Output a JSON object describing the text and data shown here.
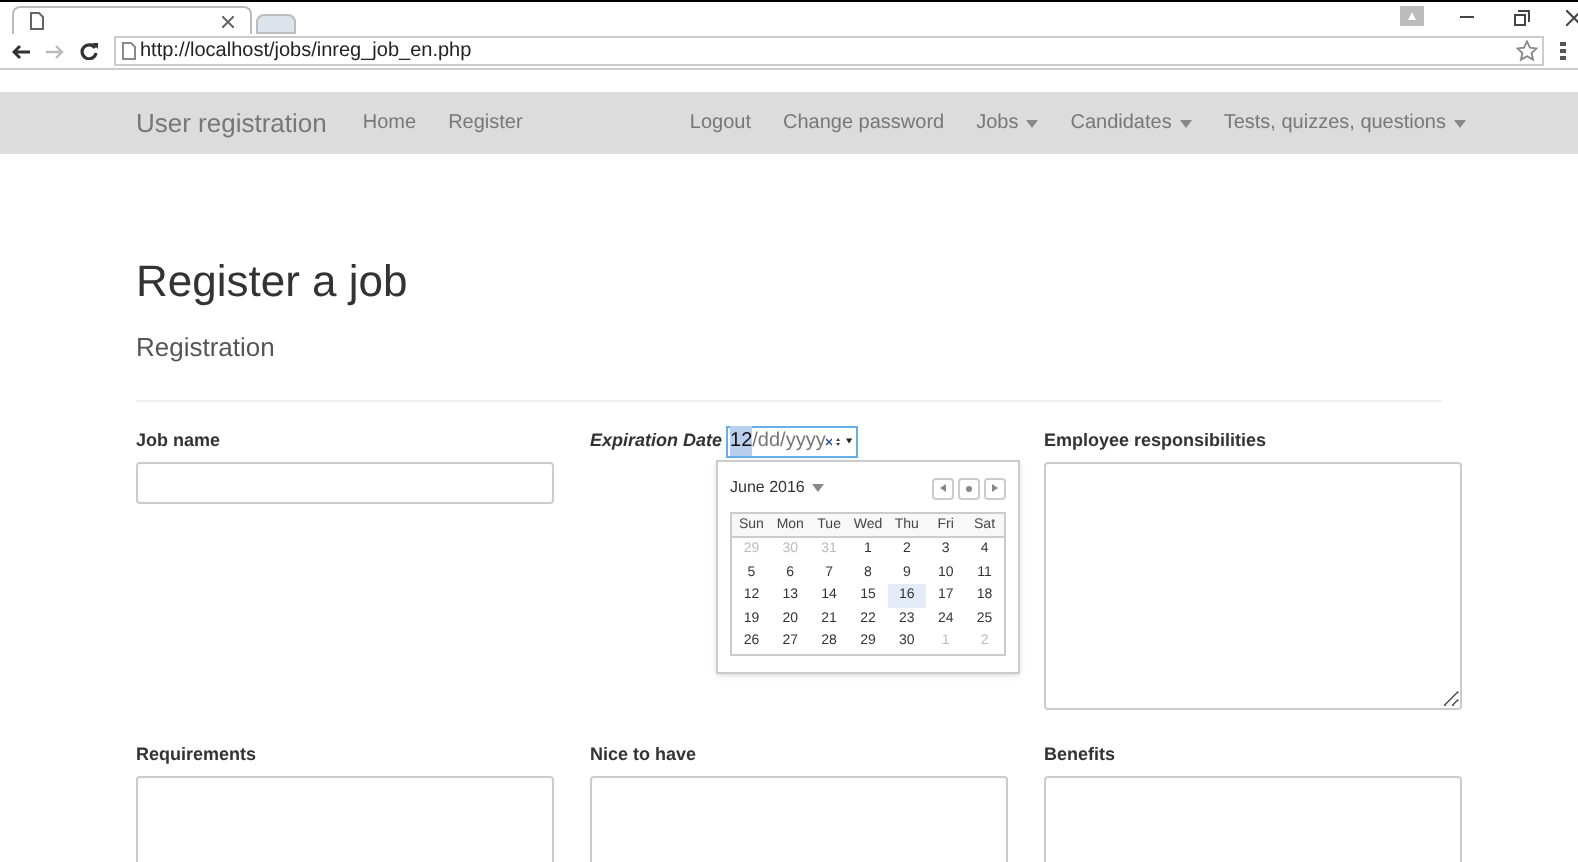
{
  "browser": {
    "url": "http://localhost/jobs/inreg_job_en.php"
  },
  "navbar": {
    "brand": "User registration",
    "left_links": [
      {
        "label": "Home",
        "dropdown": false
      },
      {
        "label": "Register",
        "dropdown": false
      }
    ],
    "right_links": [
      {
        "label": "Logout",
        "dropdown": false
      },
      {
        "label": "Change password",
        "dropdown": false
      },
      {
        "label": "Jobs",
        "dropdown": true
      },
      {
        "label": "Candidates",
        "dropdown": true
      },
      {
        "label": "Tests, quizzes, questions",
        "dropdown": true
      }
    ]
  },
  "page": {
    "title": "Register a job",
    "subtitle": "Registration"
  },
  "fields": [
    {
      "label": "Job name",
      "kind": "input",
      "italic": false
    },
    {
      "label": "Expiration Date",
      "kind": "date",
      "italic": true
    },
    {
      "label": "Employee responsibilities",
      "kind": "textarea",
      "italic": false
    },
    {
      "label": "Requirements",
      "kind": "textarea",
      "italic": false
    },
    {
      "label": "Nice to have",
      "kind": "textarea",
      "italic": false
    },
    {
      "label": "Benefits",
      "kind": "textarea",
      "italic": false
    }
  ],
  "date_field": {
    "segments": [
      {
        "text": "12",
        "selected": true
      },
      {
        "text": "/dd/yyyy",
        "selected": false
      }
    ]
  },
  "calendar": {
    "month": "June 2016",
    "weekdays": [
      "Sun",
      "Mon",
      "Tue",
      "Wed",
      "Thu",
      "Fri",
      "Sat"
    ],
    "weeks": [
      [
        {
          "day": "29",
          "muted": true,
          "selected": false
        },
        {
          "day": "30",
          "muted": true,
          "selected": false
        },
        {
          "day": "31",
          "muted": true,
          "selected": false
        },
        {
          "day": "1",
          "muted": false,
          "selected": false
        },
        {
          "day": "2",
          "muted": false,
          "selected": false
        },
        {
          "day": "3",
          "muted": false,
          "selected": false
        },
        {
          "day": "4",
          "muted": false,
          "selected": false
        }
      ],
      [
        {
          "day": "5",
          "muted": false,
          "selected": false
        },
        {
          "day": "6",
          "muted": false,
          "selected": false
        },
        {
          "day": "7",
          "muted": false,
          "selected": false
        },
        {
          "day": "8",
          "muted": false,
          "selected": false
        },
        {
          "day": "9",
          "muted": false,
          "selected": false
        },
        {
          "day": "10",
          "muted": false,
          "selected": false
        },
        {
          "day": "11",
          "muted": false,
          "selected": false
        }
      ],
      [
        {
          "day": "12",
          "muted": false,
          "selected": false
        },
        {
          "day": "13",
          "muted": false,
          "selected": false
        },
        {
          "day": "14",
          "muted": false,
          "selected": false
        },
        {
          "day": "15",
          "muted": false,
          "selected": false
        },
        {
          "day": "16",
          "muted": false,
          "selected": true
        },
        {
          "day": "17",
          "muted": false,
          "selected": false
        },
        {
          "day": "18",
          "muted": false,
          "selected": false
        }
      ],
      [
        {
          "day": "19",
          "muted": false,
          "selected": false
        },
        {
          "day": "20",
          "muted": false,
          "selected": false
        },
        {
          "day": "21",
          "muted": false,
          "selected": false
        },
        {
          "day": "22",
          "muted": false,
          "selected": false
        },
        {
          "day": "23",
          "muted": false,
          "selected": false
        },
        {
          "day": "24",
          "muted": false,
          "selected": false
        },
        {
          "day": "25",
          "muted": false,
          "selected": false
        }
      ],
      [
        {
          "day": "26",
          "muted": false,
          "selected": false
        },
        {
          "day": "27",
          "muted": false,
          "selected": false
        },
        {
          "day": "28",
          "muted": false,
          "selected": false
        },
        {
          "day": "29",
          "muted": false,
          "selected": false
        },
        {
          "day": "30",
          "muted": false,
          "selected": false
        },
        {
          "day": "1",
          "muted": true,
          "selected": false
        },
        {
          "day": "2",
          "muted": true,
          "selected": false
        }
      ]
    ]
  }
}
